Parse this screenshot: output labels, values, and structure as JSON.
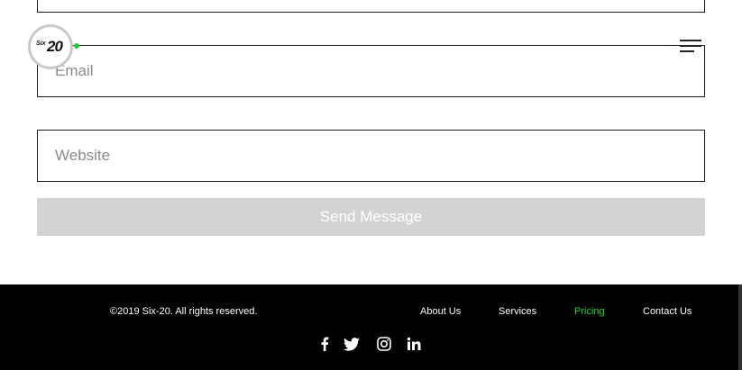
{
  "form": {
    "email_placeholder": "Email",
    "website_placeholder": "Website",
    "send_label": "Send Message"
  },
  "header": {
    "logo_prefix": "Six",
    "logo_number": "20",
    "menu_icon": "hamburger-menu-icon",
    "accent_color": "#27c93f"
  },
  "footer": {
    "copyright": "©2019 Six-20. All rights reserved.",
    "nav": [
      {
        "label": "About Us"
      },
      {
        "label": "Services"
      },
      {
        "label": "Pricing",
        "active": true
      },
      {
        "label": "Contact Us"
      }
    ],
    "active_color": "#2bd42b",
    "social": [
      "facebook-icon",
      "twitter-icon",
      "instagram-icon",
      "linkedin-icon"
    ]
  }
}
